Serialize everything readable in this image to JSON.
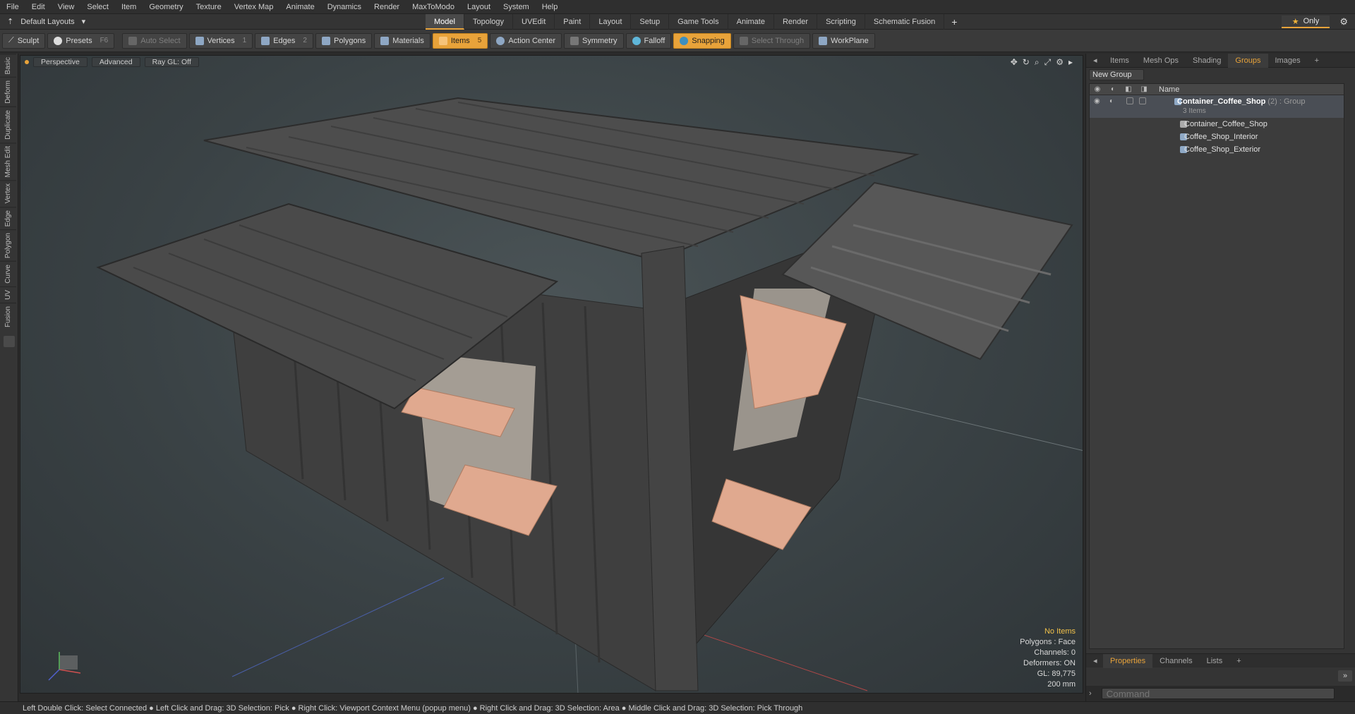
{
  "menu": [
    "File",
    "Edit",
    "View",
    "Select",
    "Item",
    "Geometry",
    "Texture",
    "Vertex Map",
    "Animate",
    "Dynamics",
    "Render",
    "MaxToModo",
    "Layout",
    "System",
    "Help"
  ],
  "layout_selector": "Default Layouts",
  "layout_tabs": [
    "Model",
    "Topology",
    "UVEdit",
    "Paint",
    "Layout",
    "Setup",
    "Game Tools",
    "Animate",
    "Render",
    "Scripting",
    "Schematic Fusion"
  ],
  "active_layout_tab": "Model",
  "only_label": "Only",
  "toolbar": {
    "sculpt": "Sculpt",
    "presets": "Presets",
    "presets_key": "F6",
    "auto_select": "Auto Select",
    "vertices": "Vertices",
    "vertices_key": "1",
    "edges": "Edges",
    "edges_key": "2",
    "polygons": "Polygons",
    "materials": "Materials",
    "items": "Items",
    "items_key": "5",
    "action_center": "Action Center",
    "symmetry": "Symmetry",
    "falloff": "Falloff",
    "snapping": "Snapping",
    "select_through": "Select Through",
    "workplane": "WorkPlane"
  },
  "left_tabs": [
    "Basic",
    "Deform",
    "Duplicate",
    "Mesh Edit",
    "Vertex",
    "Edge",
    "Polygon",
    "Curve",
    "UV",
    "Fusion"
  ],
  "viewport": {
    "view": "Perspective",
    "shading": "Advanced",
    "raygl": "Ray GL: Off",
    "info": {
      "items": "No Items",
      "polygons": "Polygons : Face",
      "channels": "Channels: 0",
      "deformers": "Deformers: ON",
      "gl": "GL: 89,775",
      "grid": "200 mm"
    }
  },
  "right_panel": {
    "tabs": [
      "Items",
      "Mesh Ops",
      "Shading",
      "Groups",
      "Images"
    ],
    "active_tab": "Groups",
    "new_group": "New Group",
    "column_name": "Name",
    "group": {
      "name": "Container_Coffee_Shop",
      "meta": "(2) : Group",
      "count": "3 Items"
    },
    "children": [
      "Container_Coffee_Shop",
      "Coffee_Shop_Interior",
      "Coffee_Shop_Exterior"
    ],
    "bottom_tabs": [
      "Properties",
      "Channels",
      "Lists"
    ],
    "active_bottom_tab": "Properties",
    "command_placeholder": "Command"
  },
  "status": "Left Double Click: Select Connected ● Left Click and Drag: 3D Selection: Pick ● Right Click: Viewport Context Menu (popup menu) ● Right Click and Drag: 3D Selection: Area ● Middle Click and Drag: 3D Selection: Pick Through",
  "colors": {
    "accent": "#e8a33a",
    "wood": "#e0a98f",
    "metal": "#3d3d3d"
  }
}
